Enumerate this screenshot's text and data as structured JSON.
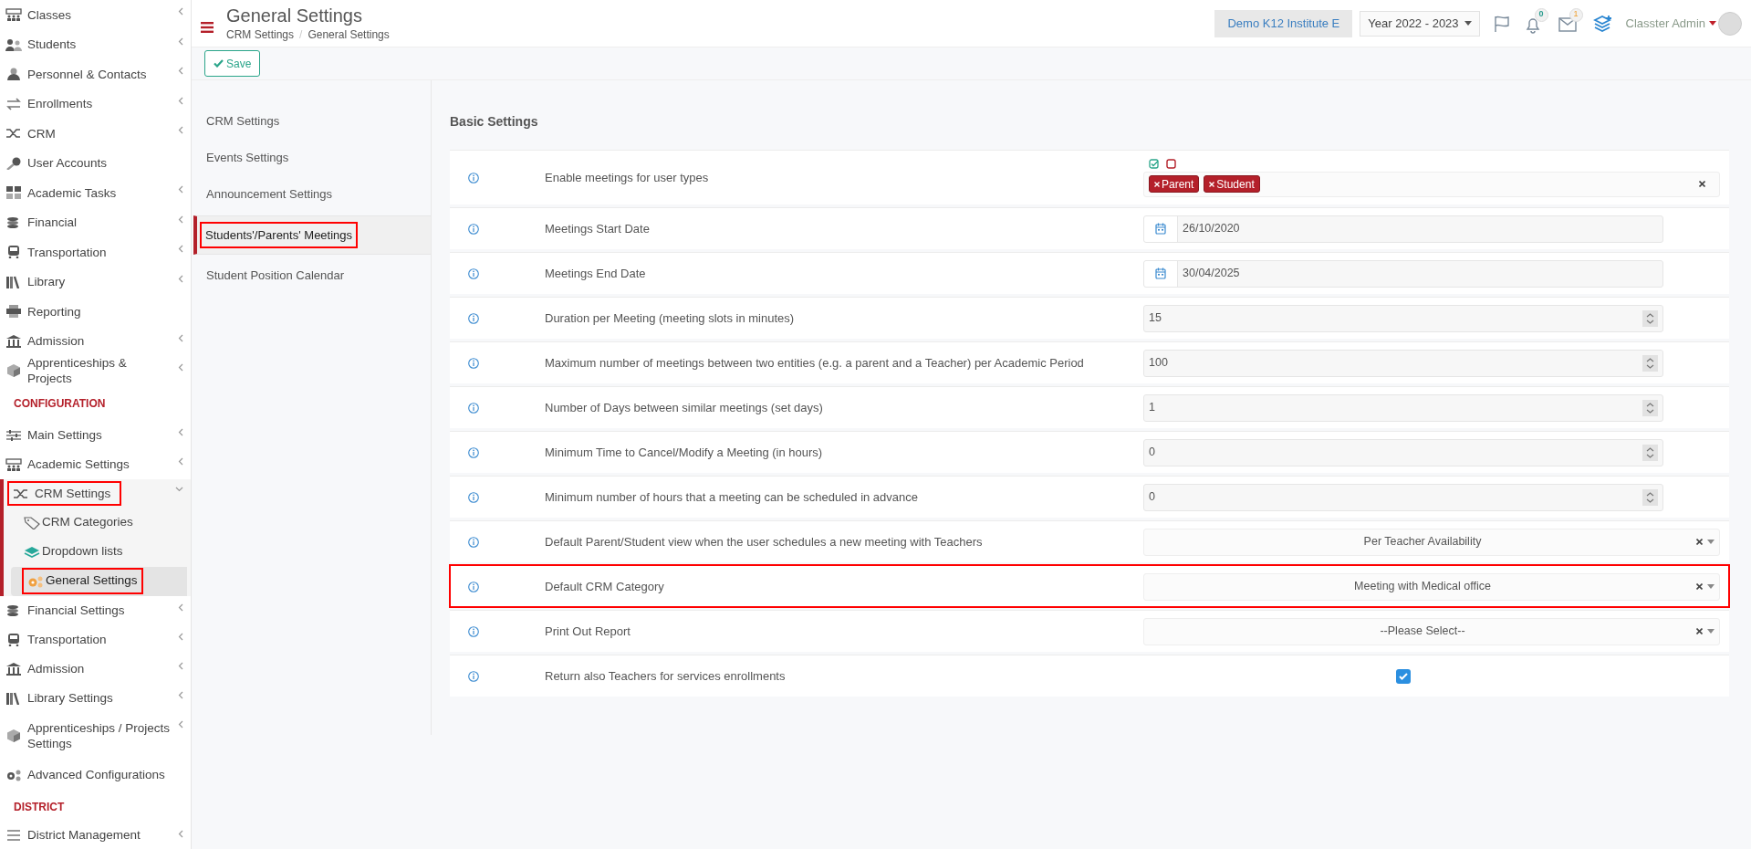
{
  "sidebar": {
    "sections": [
      {
        "items": [
          {
            "label": "Classes",
            "expandable": true,
            "expanded": false,
            "selected": false,
            "highlighted": false
          },
          {
            "label": "Students",
            "expandable": true,
            "expanded": false,
            "selected": false,
            "highlighted": false
          },
          {
            "label": "Personnel & Contacts",
            "expandable": true,
            "expanded": false,
            "selected": false,
            "highlighted": false
          },
          {
            "label": "Enrollments",
            "expandable": true,
            "expanded": false,
            "selected": false,
            "highlighted": false
          },
          {
            "label": "CRM",
            "expandable": true,
            "expanded": false,
            "selected": false,
            "highlighted": false
          },
          {
            "label": "User Accounts",
            "expandable": false,
            "expanded": false,
            "selected": false,
            "highlighted": false
          },
          {
            "label": "Academic Tasks",
            "expandable": true,
            "expanded": false,
            "selected": false,
            "highlighted": false
          },
          {
            "label": "Financial",
            "expandable": true,
            "expanded": false,
            "selected": false,
            "highlighted": false
          },
          {
            "label": "Transportation",
            "expandable": true,
            "expanded": false,
            "selected": false,
            "highlighted": false
          },
          {
            "label": "Library",
            "expandable": true,
            "expanded": false,
            "selected": false,
            "highlighted": false
          },
          {
            "label": "Reporting",
            "expandable": false,
            "expanded": false,
            "selected": false,
            "highlighted": false
          },
          {
            "label": "Admission",
            "expandable": true,
            "expanded": false,
            "selected": false,
            "highlighted": false
          },
          {
            "label": "Apprenticeships & Projects",
            "expandable": true,
            "expanded": false,
            "selected": false,
            "highlighted": false
          }
        ]
      },
      {
        "header": "CONFIGURATION",
        "items": [
          {
            "label": "Main Settings",
            "expandable": true,
            "expanded": false,
            "selected": false,
            "highlighted": false
          },
          {
            "label": "Academic Settings",
            "expandable": true,
            "expanded": false,
            "selected": false,
            "highlighted": false
          },
          {
            "label": "CRM Settings",
            "expandable": true,
            "expanded": true,
            "selected": false,
            "highlighted": true,
            "children": [
              {
                "label": "CRM Categories",
                "selected": false,
                "highlighted": false
              },
              {
                "label": "Dropdown lists",
                "selected": false,
                "highlighted": false
              },
              {
                "label": "General Settings",
                "selected": true,
                "highlighted": true
              }
            ]
          },
          {
            "label": "Financial Settings",
            "expandable": true,
            "expanded": false,
            "selected": false,
            "highlighted": false
          },
          {
            "label": "Transportation",
            "expandable": true,
            "expanded": false,
            "selected": false,
            "highlighted": false
          },
          {
            "label": "Admission",
            "expandable": true,
            "expanded": false,
            "selected": false,
            "highlighted": false
          },
          {
            "label": "Library Settings",
            "expandable": true,
            "expanded": false,
            "selected": false,
            "highlighted": false
          },
          {
            "label": "Apprenticeships / Projects Settings",
            "expandable": true,
            "expanded": false,
            "selected": false,
            "highlighted": false
          },
          {
            "label": "Advanced Configurations",
            "expandable": false,
            "expanded": false,
            "selected": false,
            "highlighted": false
          }
        ]
      },
      {
        "header": "DISTRICT",
        "items": [
          {
            "label": "District Management",
            "expandable": true,
            "expanded": false,
            "selected": false,
            "highlighted": false
          }
        ]
      }
    ]
  },
  "header": {
    "title": "General Settings",
    "breadcrumb": [
      "CRM Settings",
      "General Settings"
    ],
    "breadcrumb_separator": "/",
    "institute": "Demo K12 Institute E",
    "year": "Year 2022 - 2023",
    "notifications_badge": "0",
    "messages_badge": "1",
    "user": "Classter Admin"
  },
  "toolbar": {
    "save": "Save"
  },
  "settings_nav": [
    {
      "label": "CRM Settings",
      "selected": false,
      "highlighted": false
    },
    {
      "label": "Events Settings",
      "selected": false,
      "highlighted": false
    },
    {
      "label": "Announcement Settings",
      "selected": false,
      "highlighted": false
    },
    {
      "label": "Students'/Parents' Meetings",
      "selected": true,
      "highlighted": true
    },
    {
      "label": "Student Position Calendar",
      "selected": false,
      "highlighted": false
    }
  ],
  "panel": {
    "title": "Basic Settings",
    "rows": [
      {
        "kind": "tags",
        "label": "Enable meetings for user types",
        "tags": [
          "Parent",
          "Student"
        ],
        "highlighted": false
      },
      {
        "kind": "date",
        "label": "Meetings Start Date",
        "value": "26/10/2020",
        "highlighted": false
      },
      {
        "kind": "date",
        "label": "Meetings End Date",
        "value": "30/04/2025",
        "highlighted": false
      },
      {
        "kind": "number",
        "label": "Duration per Meeting (meeting slots in minutes)",
        "value": "15",
        "highlighted": false
      },
      {
        "kind": "number",
        "label": "Maximum number of meetings between two entities (e.g. a parent and a Teacher) per Academic Period",
        "value": "100",
        "highlighted": false
      },
      {
        "kind": "number",
        "label": "Number of Days between similar meetings (set days)",
        "value": "1",
        "highlighted": false
      },
      {
        "kind": "number",
        "label": "Minimum Time to Cancel/Modify a Meeting (in hours)",
        "value": "0",
        "highlighted": false
      },
      {
        "kind": "number",
        "label": "Minimum number of hours that a meeting can be scheduled in advance",
        "value": "0",
        "highlighted": false
      },
      {
        "kind": "select",
        "label": "Default Parent/Student view when the user schedules a new meeting with Teachers",
        "value": "Per Teacher Availability",
        "highlighted": false
      },
      {
        "kind": "select",
        "label": "Default CRM Category",
        "value": "Meeting with Medical office",
        "highlighted": true
      },
      {
        "kind": "select",
        "label": "Print Out Report",
        "value": "--Please Select--",
        "highlighted": false
      },
      {
        "kind": "checkbox",
        "label": "Return also Teachers for services enrollments",
        "checked": true,
        "highlighted": false
      }
    ]
  }
}
